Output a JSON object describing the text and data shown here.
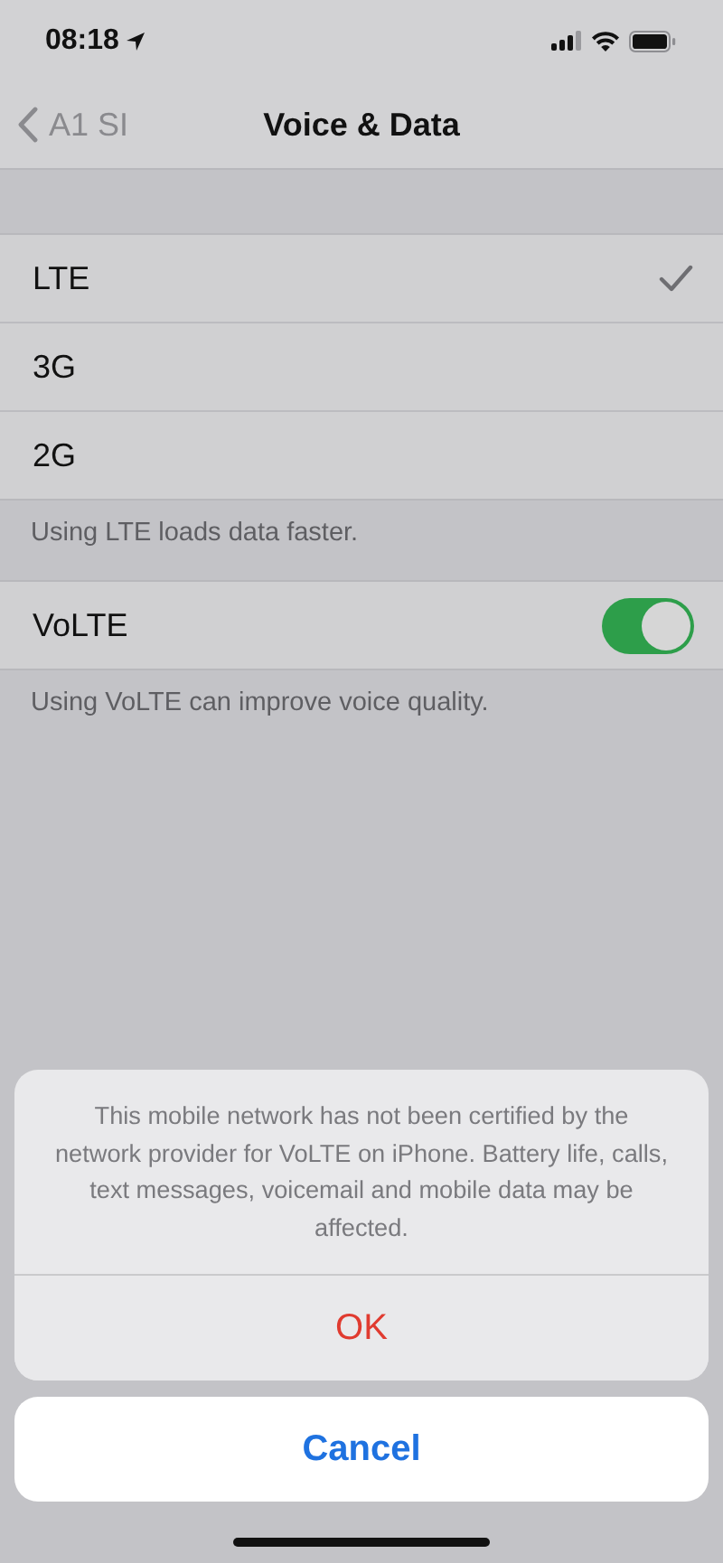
{
  "status_bar": {
    "time": "08:18"
  },
  "nav": {
    "back": "A1 SI",
    "title": "Voice & Data"
  },
  "network_options": [
    {
      "label": "LTE",
      "selected": true
    },
    {
      "label": "3G",
      "selected": false
    },
    {
      "label": "2G",
      "selected": false
    }
  ],
  "network_footer": "Using LTE loads data faster.",
  "volte": {
    "label": "VoLTE",
    "on": true
  },
  "volte_footer": "Using VoLTE can improve voice quality.",
  "action_sheet": {
    "message": "This mobile network has not been certified by the network provider for VoLTE on iPhone. Battery life, calls, text messages, voicemail and mobile data may be affected.",
    "actions": [
      {
        "label": "OK",
        "kind": "destructive"
      }
    ],
    "cancel": "Cancel"
  }
}
